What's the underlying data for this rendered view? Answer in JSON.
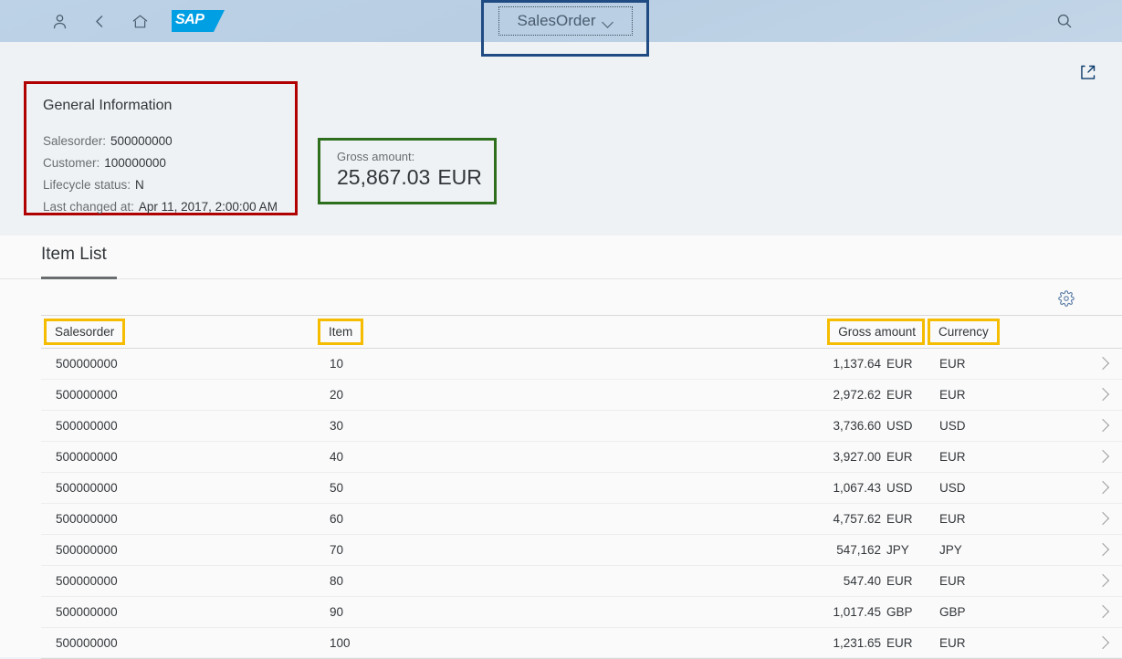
{
  "shell": {
    "icons": {
      "user": "user-icon",
      "back": "back-icon",
      "home": "home-icon",
      "logo": "sap-logo",
      "search": "search-icon"
    },
    "logo_text": "SAP",
    "app_title": "SalesOrder",
    "dropdown_icon": "chevron-down-icon"
  },
  "object_header": {
    "share_icon": "share-icon",
    "general_information": {
      "title": "General Information",
      "fields": [
        {
          "label": "Salesorder:",
          "value": "500000000"
        },
        {
          "label": "Customer:",
          "value": "100000000"
        },
        {
          "label": "Lifecycle status:",
          "value": "N"
        },
        {
          "label": "Last changed at:",
          "value": "Apr 11, 2017, 2:00:00 AM"
        }
      ]
    },
    "gross_amount": {
      "label": "Gross amount:",
      "value": "25,867.03",
      "currency": "EUR"
    }
  },
  "item_list": {
    "section_title": "Item List",
    "settings_icon": "gear-icon",
    "columns": {
      "salesorder": "Salesorder",
      "item": "Item",
      "gross_amount": "Gross amount",
      "currency": "Currency"
    },
    "rows": [
      {
        "salesorder": "500000000",
        "item": "10",
        "amount": "1,137.64",
        "unit": "EUR",
        "currency": "EUR"
      },
      {
        "salesorder": "500000000",
        "item": "20",
        "amount": "2,972.62",
        "unit": "EUR",
        "currency": "EUR"
      },
      {
        "salesorder": "500000000",
        "item": "30",
        "amount": "3,736.60",
        "unit": "USD",
        "currency": "USD"
      },
      {
        "salesorder": "500000000",
        "item": "40",
        "amount": "3,927.00",
        "unit": "EUR",
        "currency": "EUR"
      },
      {
        "salesorder": "500000000",
        "item": "50",
        "amount": "1,067.43",
        "unit": "USD",
        "currency": "USD"
      },
      {
        "salesorder": "500000000",
        "item": "60",
        "amount": "4,757.62",
        "unit": "EUR",
        "currency": "EUR"
      },
      {
        "salesorder": "500000000",
        "item": "70",
        "amount": "547,162",
        "unit": "JPY",
        "currency": "JPY"
      },
      {
        "salesorder": "500000000",
        "item": "80",
        "amount": "547.40",
        "unit": "EUR",
        "currency": "EUR"
      },
      {
        "salesorder": "500000000",
        "item": "90",
        "amount": "1,017.45",
        "unit": "GBP",
        "currency": "GBP"
      },
      {
        "salesorder": "500000000",
        "item": "100",
        "amount": "1,231.65",
        "unit": "EUR",
        "currency": "EUR"
      }
    ],
    "row_nav_icon": "chevron-right-icon"
  },
  "highlight_colors": {
    "title_box": "#1f4b82",
    "general_information_box": "#b00000",
    "gross_amount_box": "#2e6f1e",
    "column_header_box": "#f5bc00"
  }
}
